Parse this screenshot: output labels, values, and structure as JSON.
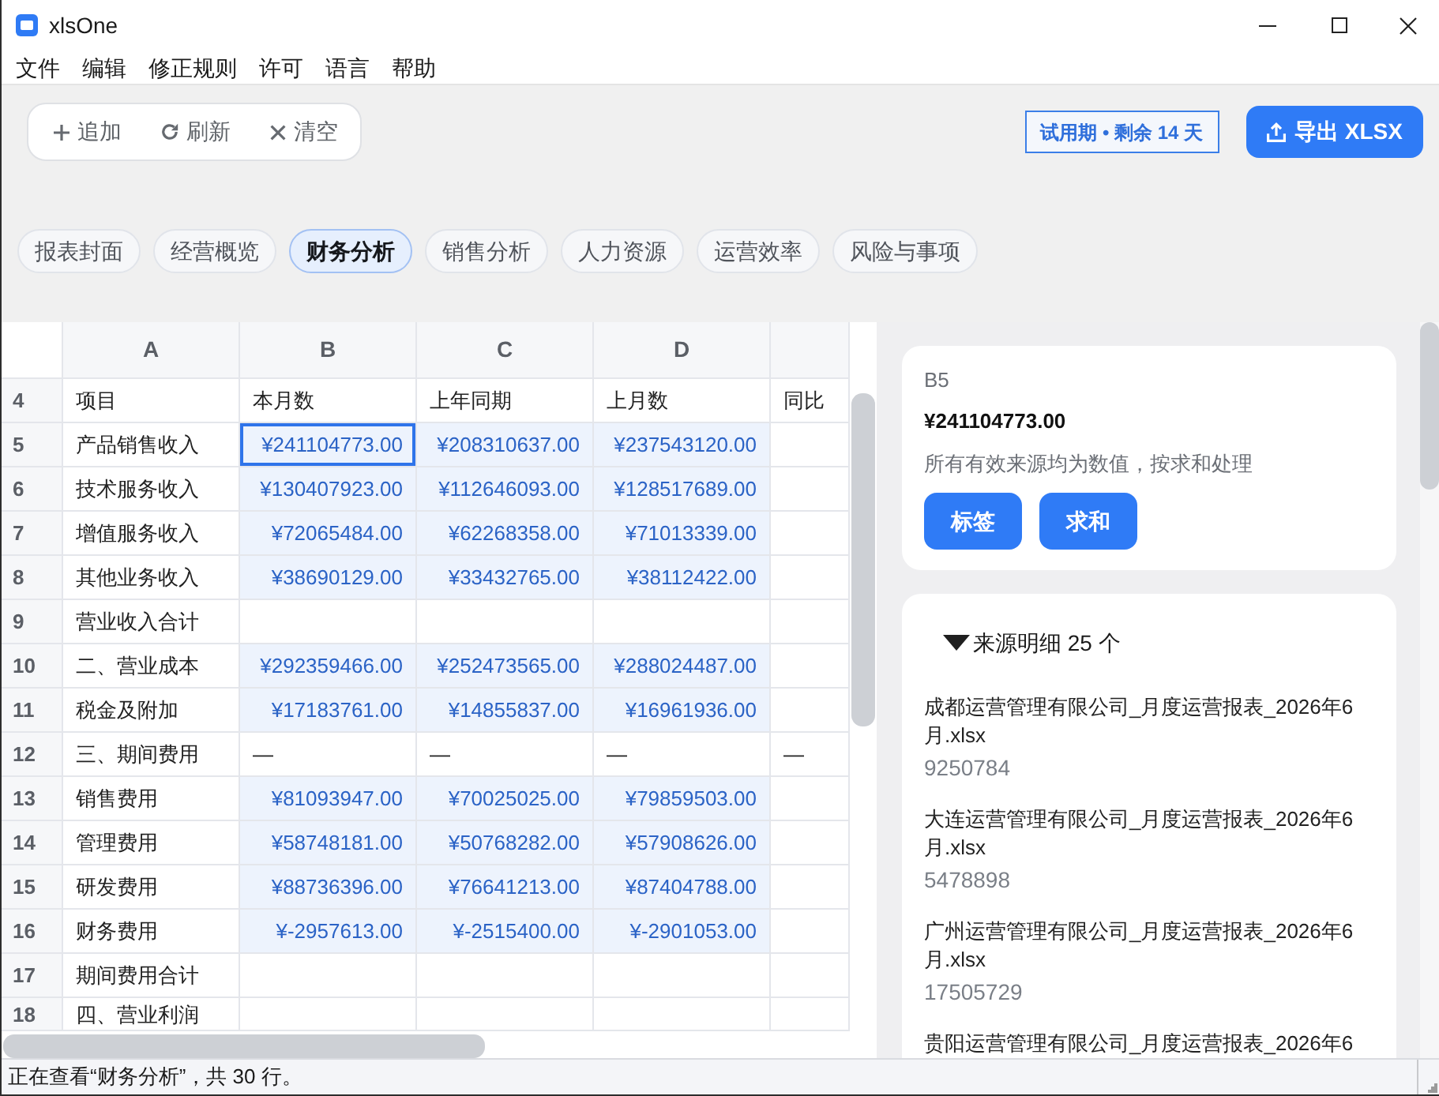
{
  "window": {
    "title": "xlsOne"
  },
  "menu": [
    "文件",
    "编辑",
    "修正规则",
    "许可",
    "语言",
    "帮助"
  ],
  "toolbar": [
    {
      "kind": "add",
      "label": "追加"
    },
    {
      "kind": "refresh",
      "label": "刷新"
    },
    {
      "kind": "clear",
      "label": "清空"
    }
  ],
  "trial_badge": "试用期 • 剩余 14 天",
  "export_button": {
    "label": "导出 XLSX"
  },
  "tabs": [
    {
      "label": "报表封面",
      "selected": false
    },
    {
      "label": "经营概览",
      "selected": false
    },
    {
      "label": "财务分析",
      "selected": true
    },
    {
      "label": "销售分析",
      "selected": false
    },
    {
      "label": "人力资源",
      "selected": false
    },
    {
      "label": "运营效率",
      "selected": false
    },
    {
      "label": "风险与事项",
      "selected": false
    }
  ],
  "sheet": {
    "columns": [
      "A",
      "B",
      "C",
      "D"
    ],
    "rows": [
      {
        "number": "4",
        "cells": [
          {
            "kind": "text",
            "text": "项目",
            "selected": false
          },
          {
            "kind": "text",
            "text": "本月数",
            "selected": false
          },
          {
            "kind": "text",
            "text": "上年同期",
            "selected": false
          },
          {
            "kind": "text",
            "text": "上月数",
            "selected": false
          },
          {
            "kind": "text",
            "text": "同比",
            "selected": false
          }
        ]
      },
      {
        "number": "5",
        "cells": [
          {
            "kind": "text",
            "text": "产品销售收入",
            "selected": false
          },
          {
            "kind": "number",
            "text": "¥241104773.00",
            "selected": true
          },
          {
            "kind": "number",
            "text": "¥208310637.00",
            "selected": false
          },
          {
            "kind": "number",
            "text": "¥237543120.00",
            "selected": false
          },
          {
            "kind": "blank",
            "selected": false
          }
        ]
      },
      {
        "number": "6",
        "cells": [
          {
            "kind": "text",
            "text": "技术服务收入",
            "selected": false
          },
          {
            "kind": "number",
            "text": "¥130407923.00",
            "selected": false
          },
          {
            "kind": "number",
            "text": "¥112646093.00",
            "selected": false
          },
          {
            "kind": "number",
            "text": "¥128517689.00",
            "selected": false
          },
          {
            "kind": "blank",
            "selected": false
          }
        ]
      },
      {
        "number": "7",
        "cells": [
          {
            "kind": "text",
            "text": "增值服务收入",
            "selected": false
          },
          {
            "kind": "number",
            "text": "¥72065484.00",
            "selected": false
          },
          {
            "kind": "number",
            "text": "¥62268358.00",
            "selected": false
          },
          {
            "kind": "number",
            "text": "¥71013339.00",
            "selected": false
          },
          {
            "kind": "blank",
            "selected": false
          }
        ]
      },
      {
        "number": "8",
        "cells": [
          {
            "kind": "text",
            "text": "其他业务收入",
            "selected": false
          },
          {
            "kind": "number",
            "text": "¥38690129.00",
            "selected": false
          },
          {
            "kind": "number",
            "text": "¥33432765.00",
            "selected": false
          },
          {
            "kind": "number",
            "text": "¥38112422.00",
            "selected": false
          },
          {
            "kind": "blank",
            "selected": false
          }
        ]
      },
      {
        "number": "9",
        "cells": [
          {
            "kind": "text",
            "text": "营业收入合计",
            "selected": false
          },
          {
            "kind": "blank",
            "selected": false
          },
          {
            "kind": "blank",
            "selected": false
          },
          {
            "kind": "blank",
            "selected": false
          },
          {
            "kind": "blank",
            "selected": false
          }
        ]
      },
      {
        "number": "10",
        "cells": [
          {
            "kind": "text",
            "text": "二、营业成本",
            "selected": false
          },
          {
            "kind": "number",
            "text": "¥292359466.00",
            "selected": false
          },
          {
            "kind": "number",
            "text": "¥252473565.00",
            "selected": false
          },
          {
            "kind": "number",
            "text": "¥288024487.00",
            "selected": false
          },
          {
            "kind": "blank",
            "selected": false
          }
        ]
      },
      {
        "number": "11",
        "cells": [
          {
            "kind": "text",
            "text": "税金及附加",
            "selected": false
          },
          {
            "kind": "number",
            "text": "¥17183761.00",
            "selected": false
          },
          {
            "kind": "number",
            "text": "¥14855837.00",
            "selected": false
          },
          {
            "kind": "number",
            "text": "¥16961936.00",
            "selected": false
          },
          {
            "kind": "blank",
            "selected": false
          }
        ]
      },
      {
        "number": "12",
        "cells": [
          {
            "kind": "text",
            "text": "三、期间费用",
            "selected": false
          },
          {
            "kind": "text",
            "text": "—",
            "selected": false
          },
          {
            "kind": "text",
            "text": "—",
            "selected": false
          },
          {
            "kind": "text",
            "text": "—",
            "selected": false
          },
          {
            "kind": "text",
            "text": "—",
            "selected": false
          }
        ]
      },
      {
        "number": "13",
        "cells": [
          {
            "kind": "text",
            "text": "销售费用",
            "selected": false
          },
          {
            "kind": "number",
            "text": "¥81093947.00",
            "selected": false
          },
          {
            "kind": "number",
            "text": "¥70025025.00",
            "selected": false
          },
          {
            "kind": "number",
            "text": "¥79859503.00",
            "selected": false
          },
          {
            "kind": "blank",
            "selected": false
          }
        ]
      },
      {
        "number": "14",
        "cells": [
          {
            "kind": "text",
            "text": "管理费用",
            "selected": false
          },
          {
            "kind": "number",
            "text": "¥58748181.00",
            "selected": false
          },
          {
            "kind": "number",
            "text": "¥50768282.00",
            "selected": false
          },
          {
            "kind": "number",
            "text": "¥57908626.00",
            "selected": false
          },
          {
            "kind": "blank",
            "selected": false
          }
        ]
      },
      {
        "number": "15",
        "cells": [
          {
            "kind": "text",
            "text": "研发费用",
            "selected": false
          },
          {
            "kind": "number",
            "text": "¥88736396.00",
            "selected": false
          },
          {
            "kind": "number",
            "text": "¥76641213.00",
            "selected": false
          },
          {
            "kind": "number",
            "text": "¥87404788.00",
            "selected": false
          },
          {
            "kind": "blank",
            "selected": false
          }
        ]
      },
      {
        "number": "16",
        "cells": [
          {
            "kind": "text",
            "text": "财务费用",
            "selected": false
          },
          {
            "kind": "number",
            "text": "¥-2957613.00",
            "selected": false
          },
          {
            "kind": "number",
            "text": "¥-2515400.00",
            "selected": false
          },
          {
            "kind": "number",
            "text": "¥-2901053.00",
            "selected": false
          },
          {
            "kind": "blank",
            "selected": false
          }
        ]
      },
      {
        "number": "17",
        "cells": [
          {
            "kind": "text",
            "text": "期间费用合计",
            "selected": false
          },
          {
            "kind": "blank",
            "selected": false
          },
          {
            "kind": "blank",
            "selected": false
          },
          {
            "kind": "blank",
            "selected": false
          },
          {
            "kind": "blank",
            "selected": false
          }
        ]
      },
      {
        "number": "18",
        "cells": [
          {
            "kind": "text",
            "text": "四、营业利润",
            "selected": false
          },
          {
            "kind": "blank",
            "selected": false
          },
          {
            "kind": "blank",
            "selected": false
          },
          {
            "kind": "blank",
            "selected": false
          },
          {
            "kind": "blank",
            "selected": false
          }
        ]
      }
    ]
  },
  "cell_detail": {
    "address": "B5",
    "value": "¥241104773.00",
    "note": "所有有效来源均为数值，按求和处理",
    "buttons": [
      "标签",
      "求和"
    ]
  },
  "sources": {
    "expanded": true,
    "title": "来源明细 25 个",
    "items": [
      {
        "file": "成都运营管理有限公司_月度运营报表_2026年6月.xlsx",
        "value": "9250784"
      },
      {
        "file": "大连运营管理有限公司_月度运营报表_2026年6月.xlsx",
        "value": "5478898"
      },
      {
        "file": "广州运营管理有限公司_月度运营报表_2026年6月.xlsx",
        "value": "17505729"
      },
      {
        "file": "贵阳运营管理有限公司_月度运营报表_2026年6"
      }
    ]
  },
  "status_bar": "正在查看“财务分析”，共 30 行。"
}
